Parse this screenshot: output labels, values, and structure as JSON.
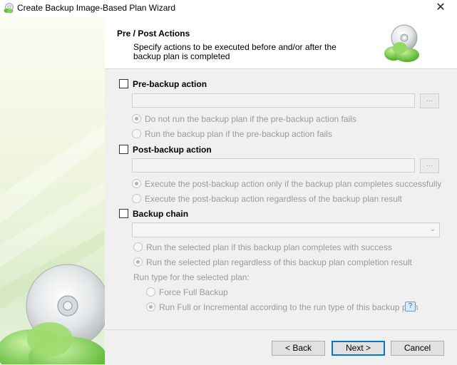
{
  "window": {
    "title": "Create Backup Image-Based Plan Wizard",
    "close_symbol": "✕"
  },
  "header": {
    "title": "Pre / Post Actions",
    "description": "Specify actions to be executed before and/or after the backup plan is completed"
  },
  "pre_backup": {
    "label": "Pre-backup action",
    "checked": false,
    "command_value": "",
    "browse_label": "...",
    "options": [
      "Do not run the backup plan if the pre-backup action fails",
      "Run the backup plan if the pre-backup action fails"
    ],
    "selected_option": 0
  },
  "post_backup": {
    "label": "Post-backup action",
    "checked": false,
    "command_value": "",
    "browse_label": "...",
    "options": [
      "Execute the post-backup action only if the backup plan completes successfully",
      "Execute the post-backup action regardless of the backup plan result"
    ],
    "selected_option": 0
  },
  "backup_chain": {
    "label": "Backup chain",
    "checked": false,
    "selected_plan": "",
    "options": [
      "Run the selected plan if this backup plan completes with success",
      "Run the selected plan regardless of this backup plan completion result"
    ],
    "selected_option": 1,
    "run_type_label": "Run type for the selected plan:",
    "run_type_options": [
      "Force Full Backup",
      "Run Full or Incremental according to the run type of this backup plan"
    ],
    "selected_run_type": 1,
    "help_icon_text": "?"
  },
  "footer": {
    "back_label": "< Back",
    "next_label": "Next >",
    "cancel_label": "Cancel"
  },
  "icons": {
    "app": "backup-disc-cloud-icon",
    "header": "disc-cloud-icon",
    "help": "help-icon"
  },
  "colors": {
    "accent_green": "#6ec63a",
    "content_bg": "#f0f0f0",
    "primary_button_border": "#0078d7"
  }
}
